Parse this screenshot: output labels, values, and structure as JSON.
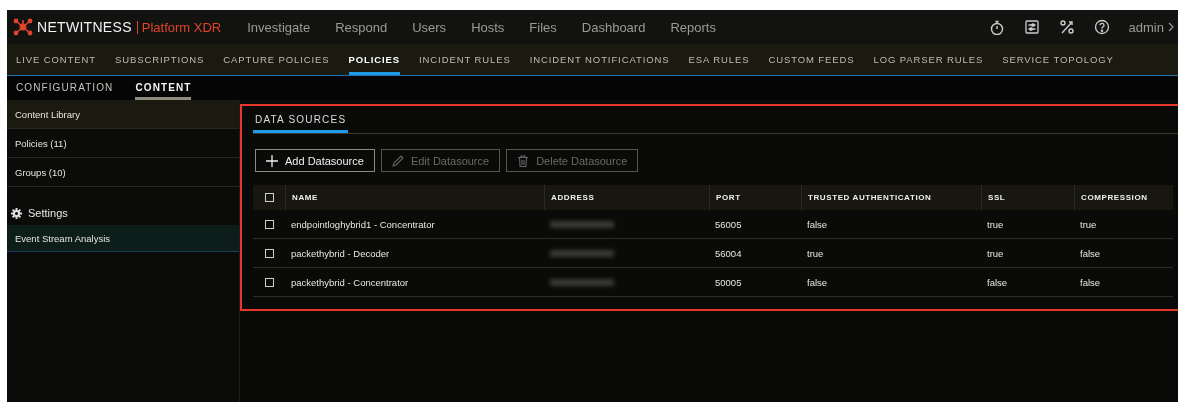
{
  "brand": {
    "name": "NETWITNESS",
    "product": "Platform XDR"
  },
  "main_nav": [
    {
      "label": "Investigate"
    },
    {
      "label": "Respond"
    },
    {
      "label": "Users"
    },
    {
      "label": "Hosts"
    },
    {
      "label": "Files"
    },
    {
      "label": "Dashboard"
    },
    {
      "label": "Reports"
    }
  ],
  "toolbar_icons": [
    {
      "kind": "stopwatch"
    },
    {
      "kind": "sliders"
    },
    {
      "kind": "tools"
    },
    {
      "kind": "help"
    }
  ],
  "user": {
    "label": "admin"
  },
  "admin_tabs": [
    {
      "label": "LIVE CONTENT",
      "selected": false
    },
    {
      "label": "SUBSCRIPTIONS",
      "selected": false
    },
    {
      "label": "CAPTURE POLICIES",
      "selected": false
    },
    {
      "label": "POLICIES",
      "selected": true
    },
    {
      "label": "INCIDENT RULES",
      "selected": false
    },
    {
      "label": "INCIDENT NOTIFICATIONS",
      "selected": false
    },
    {
      "label": "ESA RULES",
      "selected": false
    },
    {
      "label": "CUSTOM FEEDS",
      "selected": false
    },
    {
      "label": "LOG PARSER RULES",
      "selected": false
    },
    {
      "label": "SERVICE TOPOLOGY",
      "selected": false
    }
  ],
  "sub_tabs": [
    {
      "label": "CONFIGURATION",
      "selected": false
    },
    {
      "label": "CONTENT",
      "selected": true
    }
  ],
  "sidebar": {
    "items": [
      {
        "label": "Content Library",
        "selected": true
      },
      {
        "label": "Policies (11)",
        "selected": false
      },
      {
        "label": "Groups (10)",
        "selected": false
      }
    ],
    "settings_label": "Settings",
    "settings_items": [
      {
        "label": "Event Stream Analysis",
        "selected": true
      }
    ]
  },
  "panel": {
    "tabs": [
      {
        "label": "DATA SOURCES",
        "selected": true
      }
    ],
    "toolbar": [
      {
        "label": "Add Datasource",
        "kind": "add",
        "disabled": false
      },
      {
        "label": "Edit Datasource",
        "kind": "edit",
        "disabled": true
      },
      {
        "label": "Delete Datasource",
        "kind": "delete",
        "disabled": true
      }
    ],
    "table": {
      "header_checked": false,
      "columns": [
        "NAME",
        "ADDRESS",
        "PORT",
        "TRUSTED AUTHENTICATION",
        "SSL",
        "COMPRESSION"
      ],
      "rows": [
        {
          "checked": false,
          "name": "endpointloghybrid1 - Concentrator",
          "port": "56005",
          "trusted_authentication": "false",
          "ssl": "true",
          "compression": "true"
        },
        {
          "checked": false,
          "name": "packethybrid - Decoder",
          "port": "56004",
          "trusted_authentication": "true",
          "ssl": "true",
          "compression": "false"
        },
        {
          "checked": false,
          "name": "packethybrid - Concentrator",
          "port": "50005",
          "trusted_authentication": "false",
          "ssl": "false",
          "compression": "false"
        }
      ]
    }
  }
}
